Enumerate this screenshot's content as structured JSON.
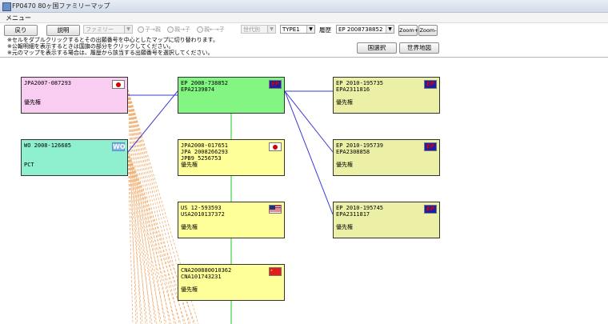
{
  "window": {
    "title": "FP0470 80ヶ国ファミリーマップ"
  },
  "menu": {
    "label": "メニュー"
  },
  "toolbar": {
    "back_label": "戻り",
    "help_label": "説明",
    "family_select": "ファミリー",
    "radio_options": [
      "子→親",
      "親→子",
      "親←→子"
    ],
    "generation_select": "世代別",
    "type_select": "TYPE1",
    "history_label": "履歴",
    "history_select": "EP  2008738852",
    "zoom_in_label": "Zoom+",
    "zoom_out_label": "Zoom-",
    "country_select_label": "国選択",
    "world_map_label": "世界地図"
  },
  "notes": [
    "※セルをダブルクリックするとその出願番号を中心としたマップに切り替わります。",
    "※公報明細を表示するときは国旗の部分をクリックしてください。",
    "※元のマップを表示する場合は、履歴から該当する出願番号を選択してください。"
  ],
  "nodes": [
    {
      "id": "n1",
      "lines": [
        "JPA2007-087293",
        "",
        "優先権"
      ],
      "flag": "jp",
      "color": "#f9ccf2"
    },
    {
      "id": "n2",
      "lines": [
        "WO 2008-126685",
        "",
        "PCT"
      ],
      "flag": "wo",
      "flag_text": "WO",
      "color": "#8ff0d0"
    },
    {
      "id": "n3",
      "lines": [
        "EP 2008-738852",
        "EPA2139874",
        ""
      ],
      "flag": "ep",
      "flag_text": "EP",
      "color": "#82f582"
    },
    {
      "id": "n4",
      "lines": [
        "JPA2008-017651",
        "JPA 2008266293",
        "JPB9 5256753",
        "優先権"
      ],
      "flag": "jp",
      "color": "#ffff99"
    },
    {
      "id": "n5",
      "lines": [
        "US 12-593593",
        "USA2010137372",
        "",
        "優先権"
      ],
      "flag": "us",
      "color": "#ffff99"
    },
    {
      "id": "n6",
      "lines": [
        "CNA200880010362",
        "CNA101743231",
        "",
        "優先権"
      ],
      "flag": "cn",
      "color": "#ffff99"
    },
    {
      "id": "n7",
      "lines": [
        "EP 2010-195735",
        "EPA2311816",
        "",
        "優先権"
      ],
      "flag": "ep",
      "flag_text": "EP",
      "color": "#ecf0a6"
    },
    {
      "id": "n8",
      "lines": [
        "EP 2010-195739",
        "EPA2308858",
        "",
        "優先権"
      ],
      "flag": "ep",
      "flag_text": "EP",
      "color": "#ecf0a6"
    },
    {
      "id": "n9",
      "lines": [
        "EP 2010-195745",
        "EPA2311817",
        "",
        "優先権"
      ],
      "flag": "ep",
      "flag_text": "EP",
      "color": "#ecf0a6"
    }
  ],
  "colors": {
    "link_blue": "#3a3ad8",
    "trunk_green": "#66dd66",
    "dashed_orange": "#f0b074"
  }
}
